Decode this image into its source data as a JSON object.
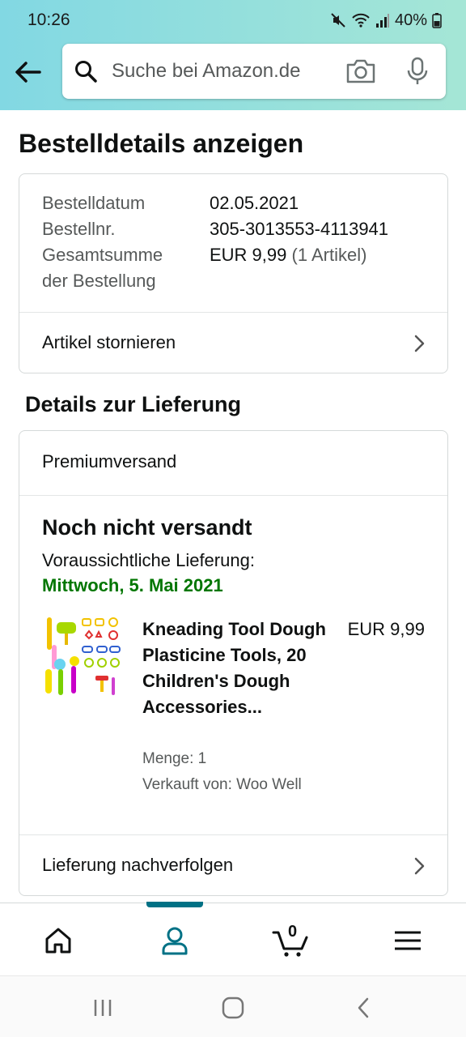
{
  "status_bar": {
    "time": "10:26",
    "battery": "40%"
  },
  "search": {
    "placeholder": "Suche bei Amazon.de"
  },
  "page_title": "Bestelldetails anzeigen",
  "order": {
    "date_label": "Bestelldatum",
    "date_value": "02.05.2021",
    "number_label": "Bestellnr.",
    "number_value": "305-3013553-4113941",
    "total_label_1": "Gesamtsumme",
    "total_label_2": "der Bestellung",
    "total_value": "EUR 9,99",
    "total_items": "(1 Artikel)",
    "cancel_label": "Artikel stornieren"
  },
  "delivery": {
    "section_title": "Details zur Lieferung",
    "shipping_method": "Premiumversand",
    "status": "Noch nicht versandt",
    "estimate_label": "Voraussichtliche Lieferung:",
    "estimate_date": "Mittwoch, 5. Mai 2021",
    "item": {
      "name": "Kneading Tool Dough Plasticine Tools, 20 Children's Dough Accessories...",
      "price": "EUR 9,99",
      "quantity": "Menge: 1",
      "seller": "Verkauft von: Woo Well"
    },
    "track_label": "Lieferung nachverfolgen"
  },
  "bottom_nav": {
    "cart_count": "0",
    "active": "account",
    "accent_color": "#007185"
  },
  "colors": {
    "delivery_date": "#007600",
    "header_start": "#82d8e3",
    "header_end": "#a5e6d6"
  }
}
